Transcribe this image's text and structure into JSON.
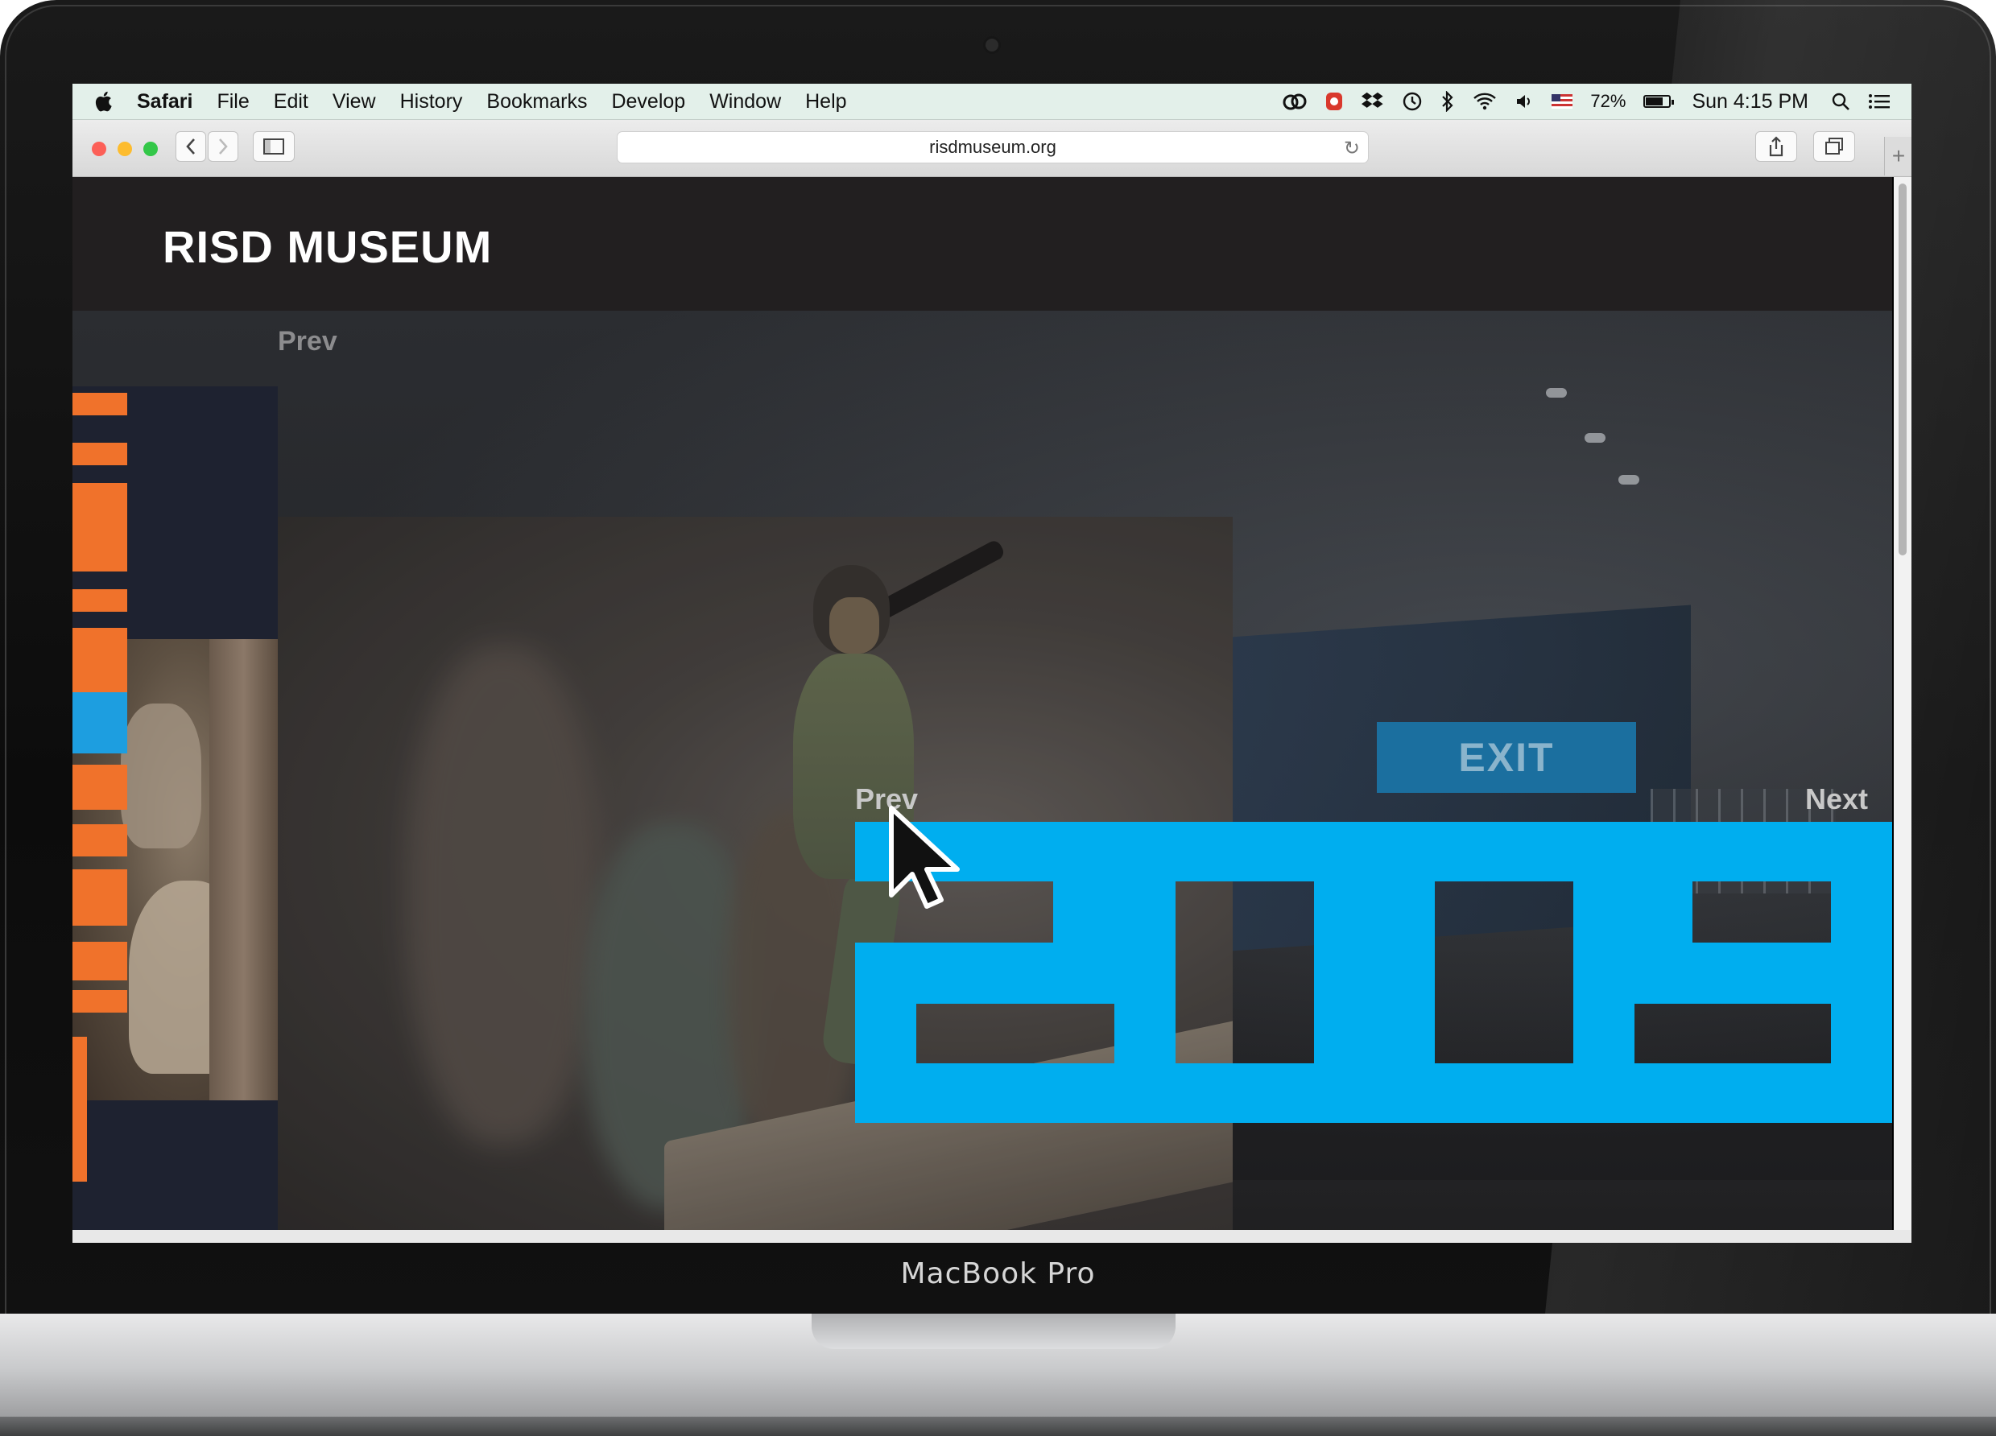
{
  "device": {
    "label": "MacBook Pro"
  },
  "menubar": {
    "app_name": "Safari",
    "items": [
      "File",
      "Edit",
      "View",
      "History",
      "Bookmarks",
      "Develop",
      "Window",
      "Help"
    ],
    "battery_percent": "72%",
    "battery_level": 0.72,
    "clock": "Sun 4:15 PM"
  },
  "toolbar": {
    "url": "risdmuseum.org",
    "traffic_colors": {
      "close": "#fc5f57",
      "minimize": "#fdbc2e",
      "zoom": "#33c748"
    }
  },
  "page": {
    "logo": "RISD MUSEUM",
    "prev_top": "Prev",
    "prev_mid": "Prev",
    "next": "Next",
    "exit": "EXIT",
    "colors": {
      "accent_blue": "#00aeef",
      "accent_orange": "#f0722b",
      "exit_bg": "#1b6f9f"
    }
  }
}
